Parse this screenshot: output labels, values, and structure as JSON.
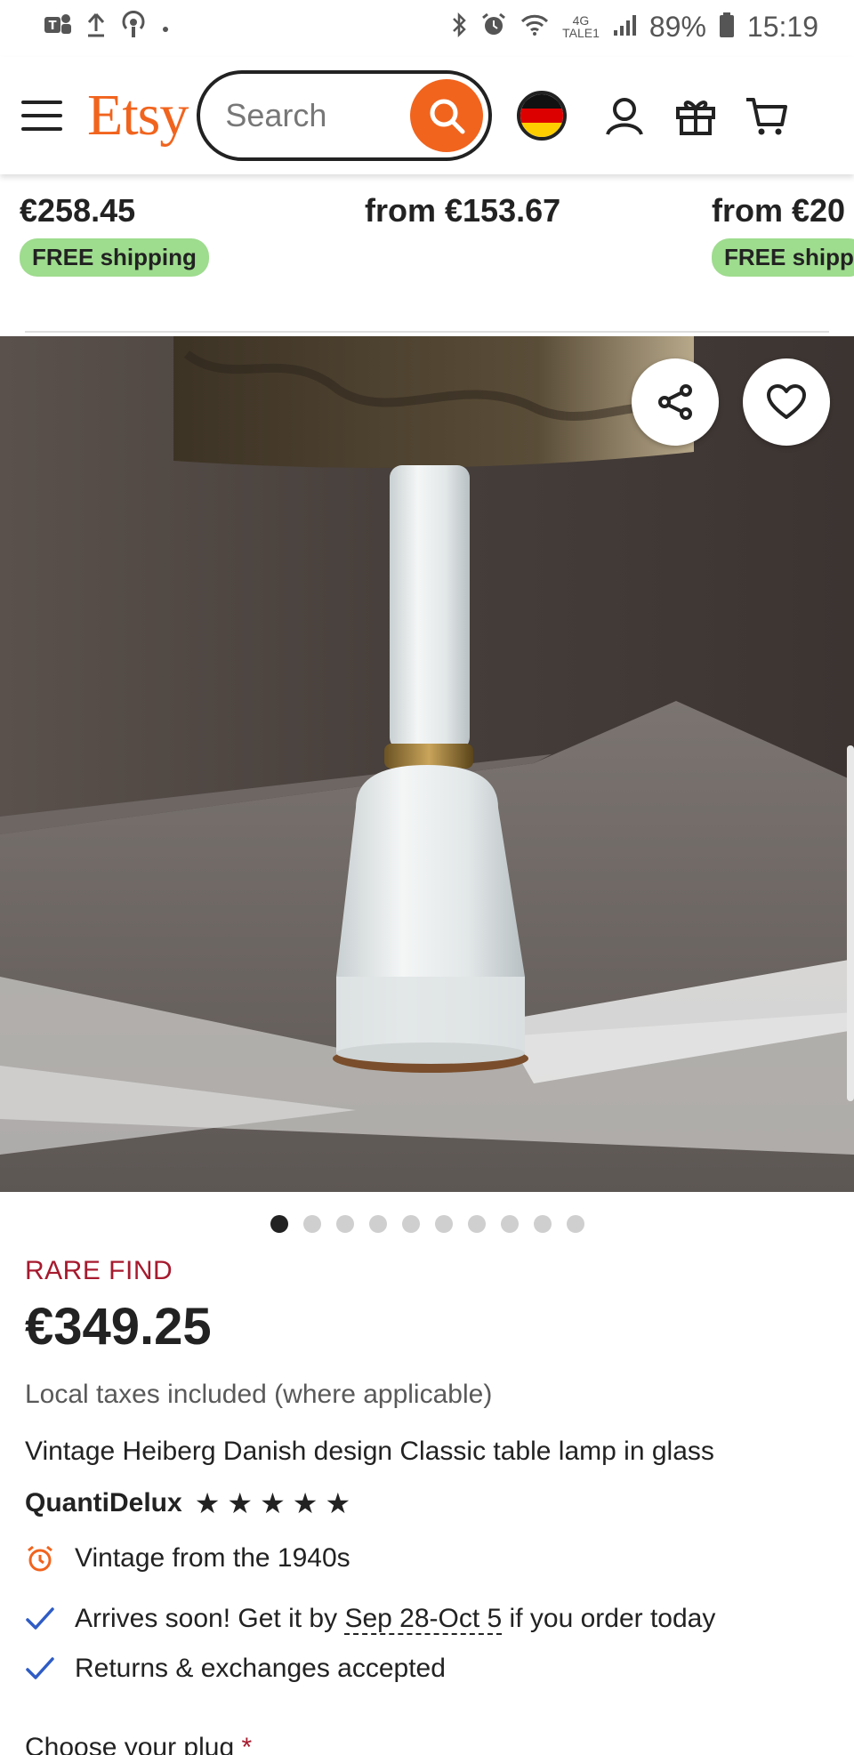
{
  "status_bar": {
    "battery": "89%",
    "time": "15:19",
    "network_label_top": "4G",
    "network_label_bottom": "TALE1"
  },
  "header": {
    "logo": "Etsy",
    "search_placeholder": "Search"
  },
  "carousel_strip": [
    {
      "price": "€258.45",
      "badge": "FREE shipping"
    },
    {
      "price": "from €153.67",
      "badge": ""
    },
    {
      "price": "from €20",
      "badge": "FREE shipp"
    }
  ],
  "gallery": {
    "dot_count": 10,
    "active_index": 0
  },
  "listing": {
    "badge": "RARE FIND",
    "price": "€349.25",
    "taxes_note": "Local taxes included (where applicable)",
    "title": "Vintage Heiberg Danish design Classic table lamp in glass",
    "shop_name": "QuantiDelux",
    "rating_stars": 5,
    "vintage_note": "Vintage from the 1940s",
    "arrival_prefix": "Arrives soon! Get it by ",
    "arrival_dates": "Sep 28-Oct 5",
    "arrival_suffix": " if you order today",
    "returns_note": "Returns & exchanges accepted",
    "plug_label": "Choose your plug ",
    "plug_required_mark": "*"
  },
  "colors": {
    "brand": "#F1641E",
    "free_shipping_bg": "#9EDC8E",
    "rare_find": "#A61A2E",
    "check": "#2F5CC5"
  },
  "icons": [
    "teams-icon",
    "upload-icon",
    "podcast-icon",
    "bluetooth-icon",
    "alarm-icon",
    "wifi-icon",
    "signal-icon",
    "battery-icon",
    "menu-icon",
    "search-icon",
    "germany-flag-icon",
    "account-icon",
    "gift-icon",
    "cart-icon",
    "share-icon",
    "heart-icon",
    "clock-icon",
    "check-icon"
  ]
}
